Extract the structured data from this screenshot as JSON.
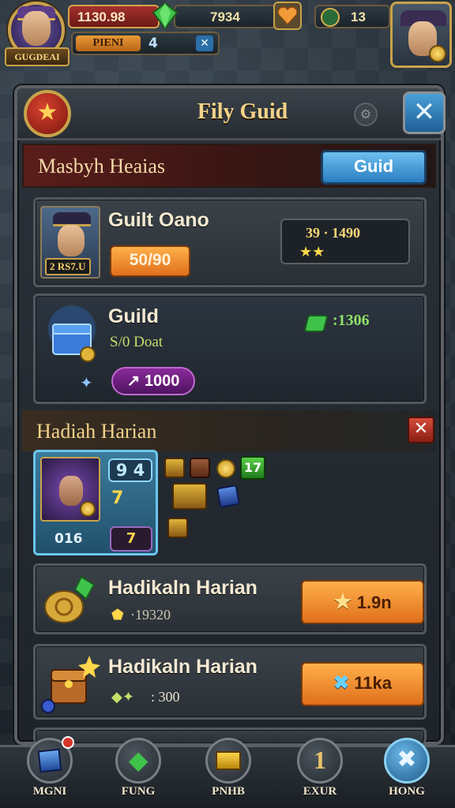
{
  "hud": {
    "player_name": "GUGDEAI",
    "red_resource": "1130.98",
    "gem_count": "7934",
    "timer_count": "13",
    "menu_label": "PIENI",
    "menu_value": "4"
  },
  "panel": {
    "title": "Fily Guid",
    "section_title": "Masbyh Heaias",
    "guild_button": "Guid"
  },
  "guild_card": {
    "title": "Guilt Oano",
    "level_tag": "2 RS7.U",
    "orange_value": "50/90",
    "stat_line_1": "39 · 1490"
  },
  "guild2_card": {
    "title": "Guild",
    "subtitle": "S/0 Doat",
    "gem_value": ":1306",
    "pill_value": "↗ 1000"
  },
  "daily": {
    "title": "Hadiah Harian",
    "hero": {
      "num_a": "9 4",
      "num_b": "7",
      "num_c": "016",
      "num_d": "7"
    }
  },
  "rewards": [
    {
      "title": "Hadikaln Harian",
      "cost": "·19320",
      "button": "1.9n"
    },
    {
      "title": "Hadikaln Harian",
      "cost": ": 300",
      "button": "11ka"
    }
  ],
  "nav": [
    {
      "label": "MGNI",
      "icon": "cube-icon"
    },
    {
      "label": "FUNG",
      "icon": "gem-icon"
    },
    {
      "label": "PNHB",
      "icon": "chest-icon"
    },
    {
      "label": "EXUR",
      "icon": "number-one-icon"
    },
    {
      "label": "HONG",
      "icon": "cross-icon"
    }
  ],
  "colors": {
    "accent_gold": "#c9a24a",
    "button_blue": "#2a7cc0",
    "button_orange": "#e0701c"
  }
}
